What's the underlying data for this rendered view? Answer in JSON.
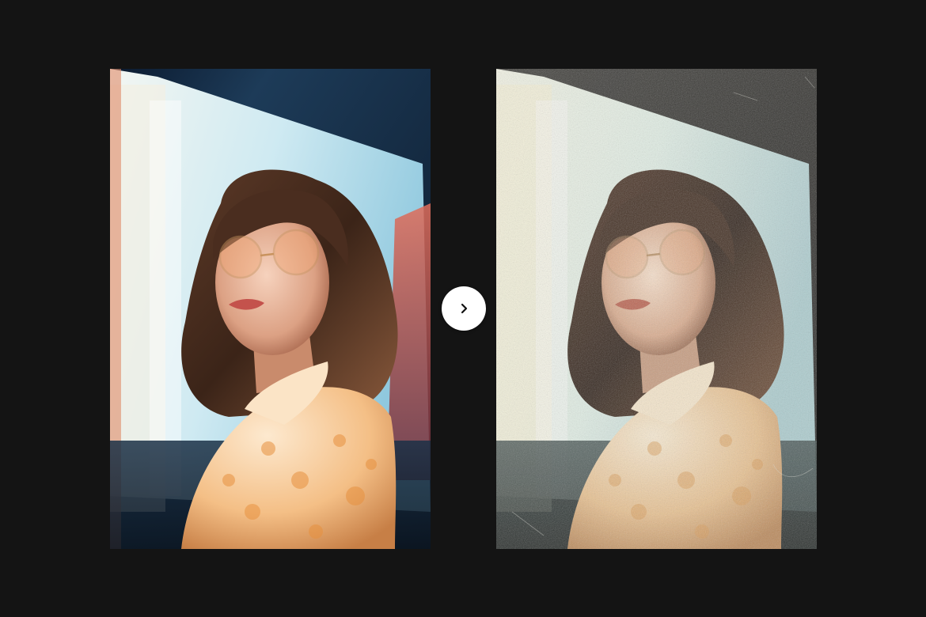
{
  "layout": {
    "background_color": "#141414"
  },
  "images": {
    "before": {
      "description_icon": "portrait-photo",
      "palette": [
        "#0c1a2e",
        "#bfe6f2",
        "#e8f2ee",
        "#d8a37a",
        "#f3c58d",
        "#4a2e22"
      ]
    },
    "after": {
      "description_icon": "portrait-photo-retro",
      "palette": [
        "#2b2b2b",
        "#9fb7a6",
        "#e6ead6",
        "#d5a37c",
        "#e9c08a",
        "#2a211c"
      ]
    }
  },
  "next_button": {
    "icon": "chevron-right-icon",
    "color": "#ffffff",
    "icon_color": "#111111"
  }
}
